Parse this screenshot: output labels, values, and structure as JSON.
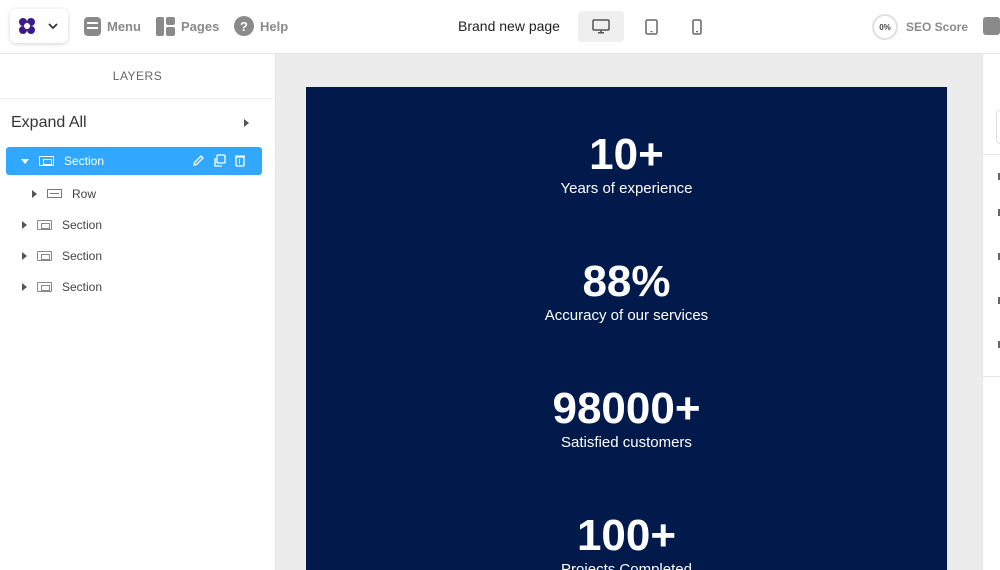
{
  "topbar": {
    "menu_label": "Menu",
    "pages_label": "Pages",
    "help_label": "Help",
    "page_name": "Brand new page",
    "seo_score_value": "0%",
    "seo_score_label": "SEO Score",
    "devices": [
      "desktop-icon",
      "tablet-icon",
      "mobile-icon"
    ],
    "active_device": "desktop"
  },
  "layers": {
    "title": "LAYERS",
    "expand_all": "Expand All",
    "items": [
      {
        "label": "Section",
        "selected": true
      },
      {
        "label": "Row"
      },
      {
        "label": "Section"
      },
      {
        "label": "Section"
      },
      {
        "label": "Section"
      }
    ]
  },
  "canvas": {
    "background_color": "#021a4b",
    "stats": [
      {
        "value": "10+",
        "label": "Years of experience"
      },
      {
        "value": "88%",
        "label": "Accuracy of our services"
      },
      {
        "value": "98000+",
        "label": "Satisfied customers"
      },
      {
        "value": "100+",
        "label": "Projects Completed"
      }
    ]
  },
  "colors": {
    "accent": "#31a8ff",
    "logo": "#3b1a8a"
  }
}
